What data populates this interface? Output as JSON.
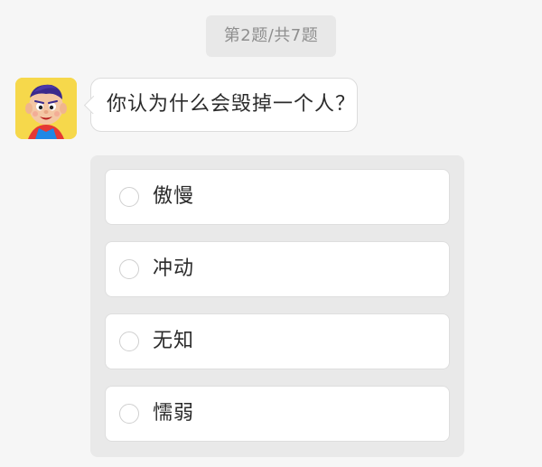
{
  "progress": "第2题/共7题",
  "question": "你认为什么会毁掉一个人？",
  "avatar_icon": "cartoon-boy-avatar",
  "options": [
    "傲慢",
    "冲动",
    "无知",
    "懦弱"
  ],
  "colors": {
    "background": "#f6f6f6",
    "panel": "#e9e9e9",
    "avatar_bg": "#f6d84b"
  }
}
